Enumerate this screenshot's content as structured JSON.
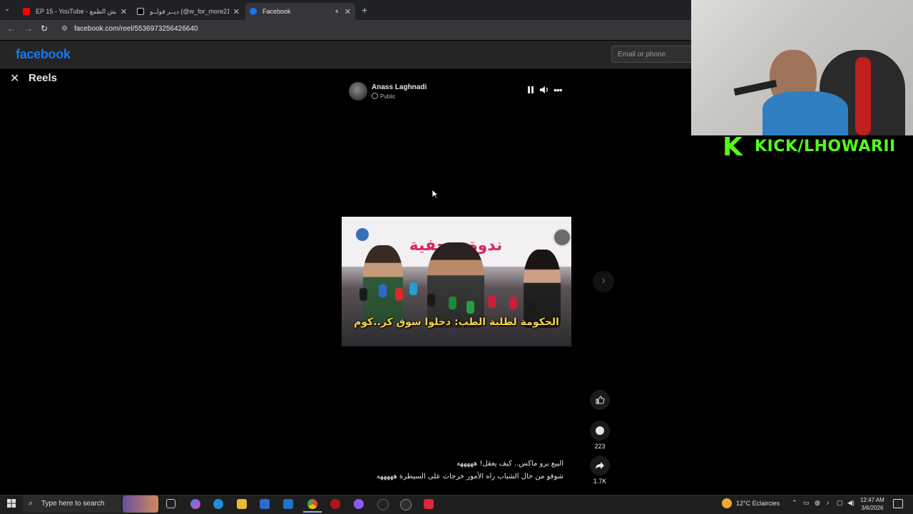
{
  "tabs": [
    {
      "title": "EP 15 - YouTube - عش الطمع",
      "favicon_color": "#ff0000",
      "icon": "youtube-icon"
    },
    {
      "title": "ديــر فولــو (@w_for_more21",
      "favicon_color": "#ffffff",
      "icon": "tiktok-icon"
    },
    {
      "title": "Facebook",
      "favicon_color": "#1877f2",
      "icon": "facebook-icon"
    }
  ],
  "address_bar": {
    "url": "facebook.com/reel/5536973256426640"
  },
  "facebook": {
    "logo": "facebook",
    "email_placeholder": "Email or phone"
  },
  "reels": {
    "title": "Reels",
    "author": "Anass Laghnadi",
    "privacy": "Public",
    "video_subtitle": "الحكومة لطلبة الطب: دخلوا سوق كر..كوم",
    "video_banner": "ندوة صحفية",
    "actions": {
      "comments_count": "223",
      "shares_count": "1.7K"
    },
    "caption_line1": "البيع برو ماكس.. كيف يعقل! هههههه",
    "caption_line2": "شوفو من حال الشباب راه الأمور خرجات على السيطرة هههههه"
  },
  "overlay": {
    "kick_text": "KICK/LHOWARII"
  },
  "taskbar": {
    "search_placeholder": "Type here to search",
    "weather": "12°C  Eclaircies",
    "time": "12:47 AM",
    "date": "3/6/2026"
  },
  "colors": {
    "facebook_blue": "#1877f2",
    "kick_green": "#53fc18",
    "subtitle_yellow": "#f4d34a"
  }
}
